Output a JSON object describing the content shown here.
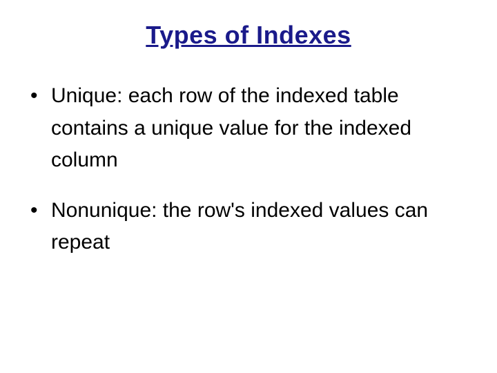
{
  "title": "Types of Indexes",
  "bullets": [
    "Unique: each row of the indexed table contains a unique value for the indexed column",
    "Nonunique: the row's indexed values can repeat"
  ]
}
